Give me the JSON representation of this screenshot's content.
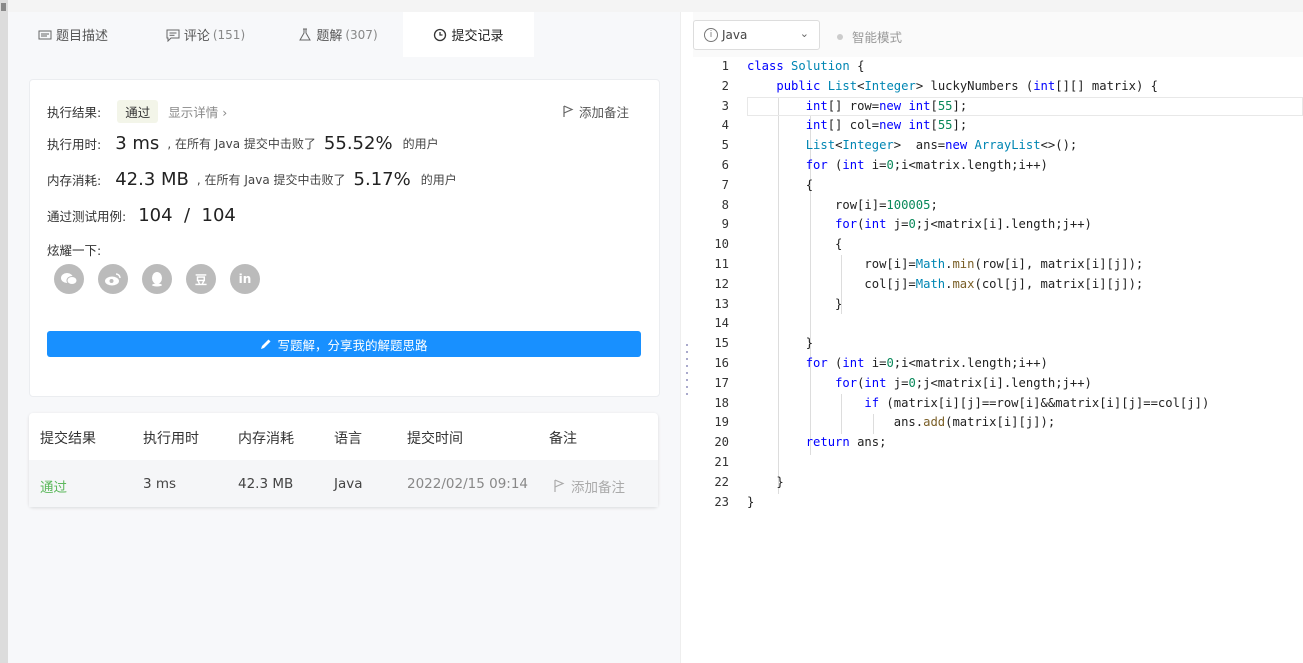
{
  "tabs": [
    {
      "label": "题目描述",
      "count": "",
      "icon": "description-icon"
    },
    {
      "label": "评论",
      "count": "(151)",
      "icon": "comment-icon"
    },
    {
      "label": "题解",
      "count": "(307)",
      "icon": "flask-icon"
    },
    {
      "label": "提交记录",
      "count": "",
      "icon": "clock-icon"
    }
  ],
  "result": {
    "label": "执行结果:",
    "status": "通过",
    "detail": "显示详情 ›",
    "add_note": "添加备注",
    "time_label": "执行用时:",
    "time_value": "3 ms",
    "time_text": ", 在所有 Java 提交中击败了",
    "time_pct": "55.52%",
    "time_suffix": "的用户",
    "mem_label": "内存消耗:",
    "mem_value": "42.3 MB",
    "mem_text": ", 在所有 Java 提交中击败了",
    "mem_pct": "5.17%",
    "mem_suffix": "的用户",
    "cases_label": "通过测试用例:",
    "cases_value": "104  /  104",
    "share_label": "炫耀一下:",
    "share_icons": [
      "wechat-icon",
      "weibo-icon",
      "qq-icon",
      "douban-icon",
      "linkedin-icon"
    ],
    "share_glyphs": [
      "",
      "",
      "",
      "豆",
      "in"
    ],
    "write_button": "写题解，分享我的解题思路"
  },
  "table": {
    "headers": [
      "提交结果",
      "执行用时",
      "内存消耗",
      "语言",
      "提交时间",
      "备注"
    ],
    "row": {
      "status": "通过",
      "time": "3 ms",
      "memory": "42.3 MB",
      "language": "Java",
      "submitted": "2022/02/15 09:14",
      "note": "添加备注"
    }
  },
  "editor": {
    "language": "Java",
    "mode": "智能模式",
    "lines": [
      "class Solution {",
      "    public List<Integer> luckyNumbers (int[][] matrix) {",
      "        int[] row=new int[55];",
      "        int[] col=new int[55];",
      "        List<Integer>  ans=new ArrayList<>();",
      "        for (int i=0;i<matrix.length;i++)",
      "        {",
      "            row[i]=100005;",
      "            for(int j=0;j<matrix[i].length;j++)",
      "            {",
      "                row[i]=Math.min(row[i], matrix[i][j]);",
      "                col[j]=Math.max(col[j], matrix[i][j]);",
      "            }",
      "",
      "        }",
      "        for (int i=0;i<matrix.length;i++)",
      "            for(int j=0;j<matrix[i].length;j++)",
      "                if (matrix[i][j]==row[i]&&matrix[i][j]==col[j])",
      "                    ans.add(matrix[i][j]);",
      "        return ans;",
      "",
      "    }",
      "}"
    ]
  },
  "colors": {
    "accent": "#1890ff",
    "pass": "#5cb85c",
    "keyword": "#0000ff",
    "type": "#0086b3",
    "number": "#09885a"
  }
}
